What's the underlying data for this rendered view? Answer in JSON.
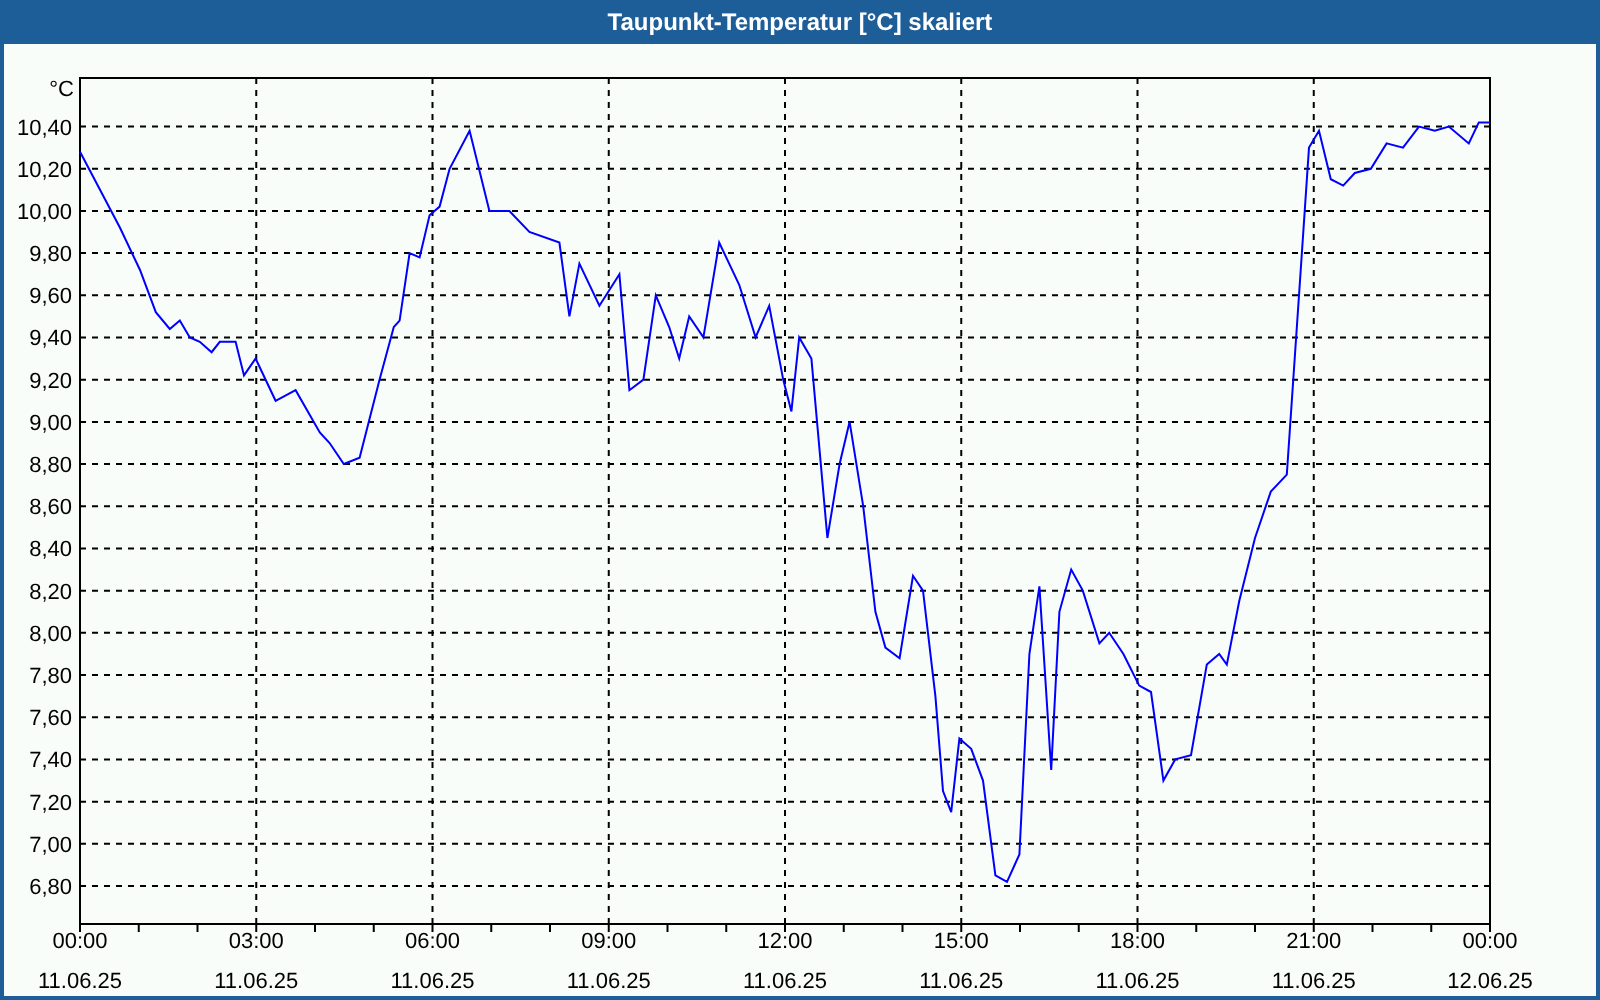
{
  "window": {
    "title": "Taupunkt-Temperatur [°C] skaliert"
  },
  "chart": {
    "x_dates": [
      "11.06.25",
      "11.06.25",
      "11.06.25",
      "11.06.25",
      "11.06.25",
      "11.06.25",
      "11.06.25",
      "11.06.25",
      "12.06.25"
    ],
    "chart_data": {
      "type": "line",
      "grid": true,
      "ylabel": "°C",
      "xlim": [
        0,
        24
      ],
      "ylim": [
        6.62,
        10.63
      ],
      "xticks": [
        {
          "value": 0,
          "label": "00:00"
        },
        {
          "value": 3,
          "label": "03:00"
        },
        {
          "value": 6,
          "label": "06:00"
        },
        {
          "value": 9,
          "label": "09:00"
        },
        {
          "value": 12,
          "label": "12:00"
        },
        {
          "value": 15,
          "label": "15:00"
        },
        {
          "value": 18,
          "label": "18:00"
        },
        {
          "value": 21,
          "label": "21:00"
        },
        {
          "value": 24,
          "label": "00:00"
        }
      ],
      "yticks": [
        {
          "value": 6.8,
          "label": "6,80"
        },
        {
          "value": 7.0,
          "label": "7,00"
        },
        {
          "value": 7.2,
          "label": "7,20"
        },
        {
          "value": 7.4,
          "label": "7,40"
        },
        {
          "value": 7.6,
          "label": "7,60"
        },
        {
          "value": 7.8,
          "label": "7,80"
        },
        {
          "value": 8.0,
          "label": "8,00"
        },
        {
          "value": 8.2,
          "label": "8,20"
        },
        {
          "value": 8.4,
          "label": "8,40"
        },
        {
          "value": 8.6,
          "label": "8,60"
        },
        {
          "value": 8.8,
          "label": "8,80"
        },
        {
          "value": 9.0,
          "label": "9,00"
        },
        {
          "value": 9.2,
          "label": "9,20"
        },
        {
          "value": 9.4,
          "label": "9,40"
        },
        {
          "value": 9.6,
          "label": "9,60"
        },
        {
          "value": 9.8,
          "label": "9,80"
        },
        {
          "value": 10.0,
          "label": "10,00"
        },
        {
          "value": 10.2,
          "label": "10,20"
        },
        {
          "value": 10.4,
          "label": "10,40"
        }
      ],
      "x": [
        0,
        0.34,
        0.68,
        1.02,
        1.29,
        1.53,
        1.7,
        1.87,
        2.04,
        2.24,
        2.38,
        2.65,
        2.79,
        2.99,
        3.33,
        3.67,
        4.08,
        4.25,
        4.49,
        4.76,
        5.1,
        5.34,
        5.44,
        5.61,
        5.78,
        5.95,
        6.12,
        6.29,
        6.63,
        6.97,
        7.31,
        7.65,
        8.16,
        8.33,
        8.5,
        8.84,
        9.18,
        9.35,
        9.59,
        9.8,
        10.03,
        10.2,
        10.37,
        10.61,
        10.88,
        11.22,
        11.5,
        11.73,
        11.97,
        12.11,
        12.24,
        12.45,
        12.72,
        12.93,
        13.1,
        13.33,
        13.54,
        13.71,
        13.95,
        14.18,
        14.35,
        14.56,
        14.69,
        14.83,
        14.97,
        15.17,
        15.37,
        15.58,
        15.78,
        15.99,
        16.16,
        16.33,
        16.53,
        16.67,
        16.87,
        17.07,
        17.35,
        17.52,
        17.76,
        18.03,
        18.23,
        18.44,
        18.64,
        18.91,
        19.18,
        19.39,
        19.52,
        19.73,
        20.0,
        20.27,
        20.54,
        20.75,
        20.92,
        21.09,
        21.29,
        21.5,
        21.7,
        21.97,
        22.24,
        22.52,
        22.79,
        23.06,
        23.3,
        23.64,
        23.81,
        24
      ],
      "series": [
        {
          "color": "#0000ff",
          "values": [
            10.28,
            10.1,
            9.92,
            9.72,
            9.52,
            9.44,
            9.48,
            9.4,
            9.38,
            9.33,
            9.38,
            9.38,
            9.22,
            9.3,
            9.1,
            9.15,
            8.95,
            8.9,
            8.8,
            8.83,
            9.2,
            9.45,
            9.48,
            9.8,
            9.78,
            9.98,
            10.02,
            10.2,
            10.38,
            10.0,
            10.0,
            9.9,
            9.85,
            9.5,
            9.75,
            9.55,
            9.7,
            9.15,
            9.2,
            9.6,
            9.45,
            9.3,
            9.5,
            9.4,
            9.85,
            9.65,
            9.4,
            9.55,
            9.2,
            9.05,
            9.4,
            9.3,
            8.45,
            8.8,
            9.0,
            8.6,
            8.1,
            7.93,
            7.88,
            8.27,
            8.2,
            7.7,
            7.25,
            7.15,
            7.5,
            7.45,
            7.3,
            6.85,
            6.82,
            6.95,
            7.9,
            8.22,
            7.35,
            8.1,
            8.3,
            8.2,
            7.95,
            8.0,
            7.9,
            7.75,
            7.72,
            7.3,
            7.4,
            7.42,
            7.85,
            7.9,
            7.85,
            8.15,
            8.45,
            8.67,
            8.75,
            9.6,
            10.3,
            10.38,
            10.15,
            10.12,
            10.18,
            10.2,
            10.32,
            10.3,
            10.4,
            10.38,
            10.4,
            10.32,
            10.42,
            10.42
          ]
        }
      ]
    }
  }
}
